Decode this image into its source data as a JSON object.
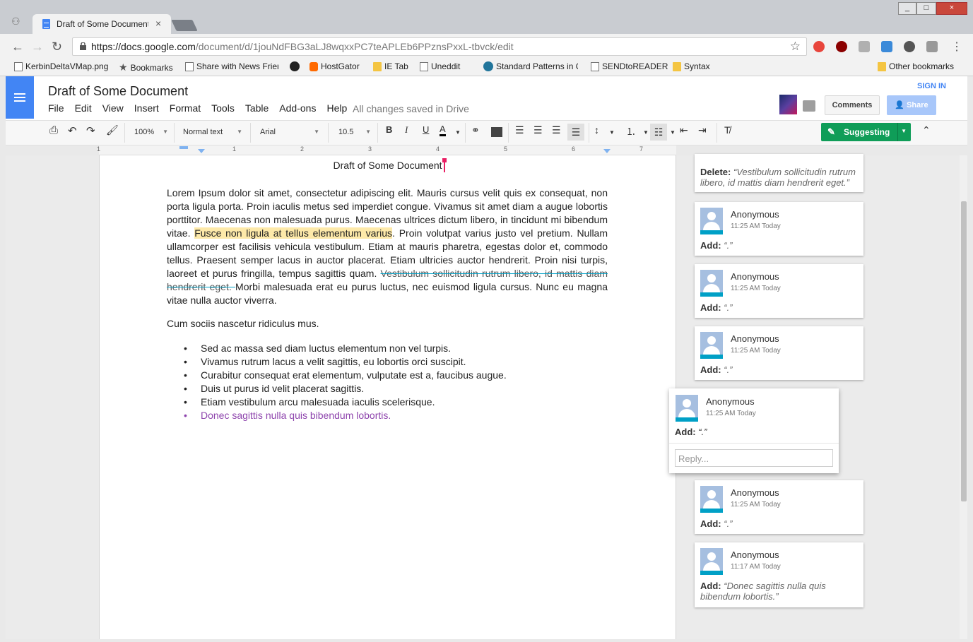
{
  "browser": {
    "tab_title": "Draft of Some Document",
    "tab_close": "×",
    "url_host": "https://docs.google.com",
    "url_path": "/document/d/1jouNdFBG3aLJ8wqxxPC7teAPLEb6PPznsPxxL-tbvck/edit",
    "bookmarks": [
      {
        "label": "KerbinDeltaVMap.png",
        "icon": "page-icon"
      },
      {
        "label": "Bookmarks",
        "icon": "star-icon"
      },
      {
        "label": "Share with News Frier",
        "icon": "page-icon"
      },
      {
        "label": "",
        "icon": "face-icon"
      },
      {
        "label": "HostGator",
        "icon": "hostgator-icon"
      },
      {
        "label": "IE Tab",
        "icon": "folder-icon"
      },
      {
        "label": "Uneddit",
        "icon": "page-icon"
      },
      {
        "label": "Standard Patterns in C",
        "icon": "wordpress-icon"
      },
      {
        "label": "SENDtoREADER",
        "icon": "page-icon"
      },
      {
        "label": "Syntax",
        "icon": "folder-icon"
      }
    ],
    "other_bookmarks": "Other bookmarks",
    "window_buttons": [
      "_",
      "□",
      "×"
    ]
  },
  "docs": {
    "title": "Draft of Some Document",
    "menu": [
      "File",
      "Edit",
      "View",
      "Insert",
      "Format",
      "Tools",
      "Table",
      "Add-ons",
      "Help"
    ],
    "saved_status": "All changes saved in Drive",
    "sign_in": "SIGN IN",
    "comments_button": "Comments",
    "share_button": "Share",
    "toolbar": {
      "zoom": "100%",
      "style": "Normal text",
      "font": "Arial",
      "size": "10.5",
      "bold": "B",
      "italic": "I",
      "underline": "U",
      "text_color": "A",
      "mode": "Suggesting"
    },
    "ruler_numbers": [
      "1",
      "1",
      "2",
      "3",
      "4",
      "5",
      "6",
      "7"
    ]
  },
  "document": {
    "heading": "Draft of Some Document",
    "para1_a": "Lorem Ipsum dolor sit amet, consectetur adipiscing elit. Mauris cursus velit quis ex consequat, non porta ligula porta. Proin iaculis metus sed imperdiet congue. Vivamus sit amet diam a augue lobortis porttitor. Maecenas non malesuada purus. Maecenas ultrices dictum libero, in tincidunt mi bibendum vitae. ",
    "para1_highlight": "Fusce non ligula at tellus elementum varius",
    "para1_b": ". Proin volutpat varius justo vel pretium. Nullam ullamcorper est facilisis vehicula vestibulum. Etiam at mauris pharetra, egestas dolor et, commodo tellus. Praesent semper lacus in auctor placerat. Etiam ultricies auctor hendrerit. Proin nisi turpis, laoreet et purus fringilla, tempus sagittis quam. ",
    "para1_deleted": "Vestibulum sollicitudin rutrum libero, id mattis diam hendrerit eget. ",
    "para1_c": "Morbi malesuada erat eu purus luctus, nec euismod ligula cursus. Nunc eu magna vitae nulla auctor viverra.",
    "para2": "Cum sociis nascetur ridiculus mus.",
    "bullets": [
      "Sed ac massa sed diam luctus elementum non vel turpis.",
      "Vivamus rutrum lacus a velit sagittis, eu lobortis orci suscipit.",
      "Curabitur consequat erat elementum, vulputate est a, faucibus augue.",
      "Duis ut purus id velit placerat sagittis.",
      "Etiam vestibulum arcu malesuada iaculis scelerisque.",
      "Donec sagittis nulla quis bibendum lobortis."
    ]
  },
  "suggestions": {
    "top": {
      "action": "Delete:",
      "text": "“Vestibulum sollicitudin rutrum libero, id mattis diam hendrerit eget.”"
    },
    "cards": [
      {
        "name": "Anonymous",
        "time": "11:25 AM Today",
        "action": "Add:",
        "text": "“.”"
      },
      {
        "name": "Anonymous",
        "time": "11:25 AM Today",
        "action": "Add:",
        "text": "“.”"
      },
      {
        "name": "Anonymous",
        "time": "11:25 AM Today",
        "action": "Add:",
        "text": "“.”"
      },
      {
        "name": "Anonymous",
        "time": "11:25 AM Today",
        "action": "Add:",
        "text": "“.”"
      },
      {
        "name": "Anonymous",
        "time": "11:17 AM Today",
        "action": "Add:",
        "text": "“Donec sagittis nulla quis bibendum lobortis.”"
      }
    ],
    "active": {
      "name": "Anonymous",
      "time": "11:25 AM Today",
      "action": "Add:",
      "text": "“.”",
      "reply_placeholder": "Reply..."
    }
  },
  "colors": {
    "accent": "#4285f4",
    "suggesting": "#0f9d58",
    "highlight": "#fde9a9",
    "strike": "#00a0c6",
    "suggest_text": "#8e44ad"
  }
}
